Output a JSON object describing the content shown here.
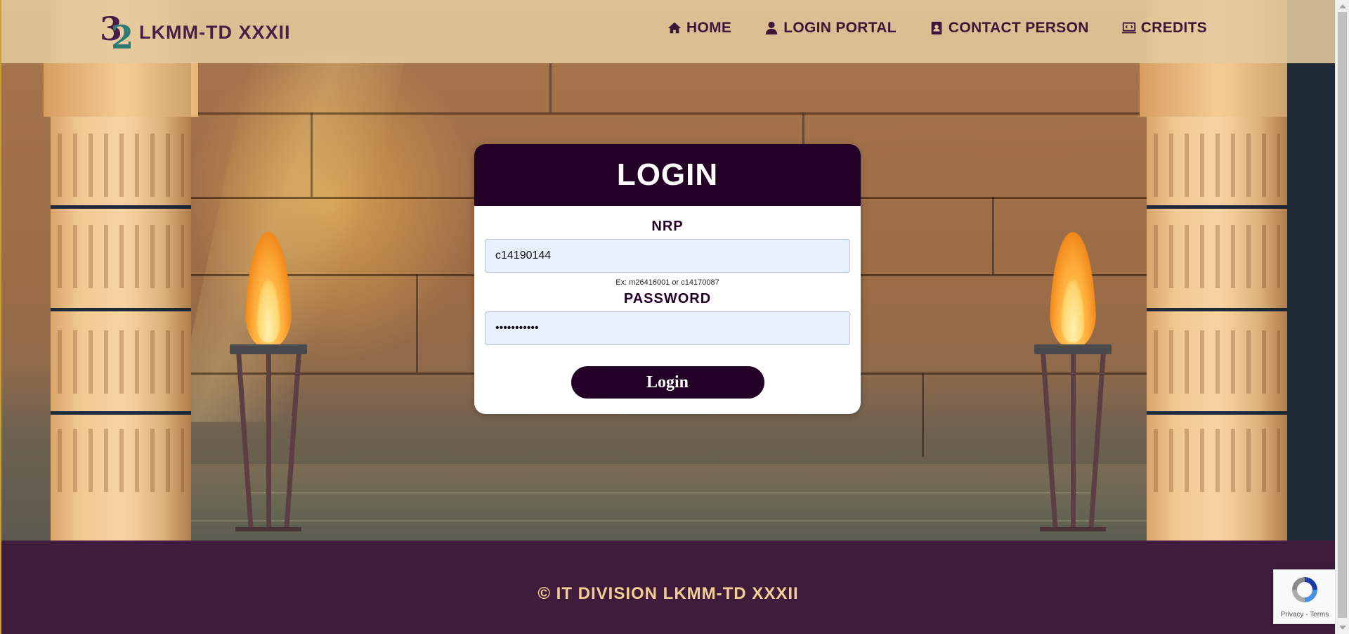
{
  "brand": {
    "name": "LKMM-TD XXXII",
    "logo_text_1": "3",
    "logo_text_2": "2"
  },
  "nav": {
    "items": [
      {
        "label": "HOME",
        "icon": "home-icon"
      },
      {
        "label": "LOGIN PORTAL",
        "icon": "user-icon"
      },
      {
        "label": "CONTACT PERSON",
        "icon": "contact-book-icon"
      },
      {
        "label": "CREDITS",
        "icon": "laptop-code-icon"
      }
    ]
  },
  "login": {
    "title": "LOGIN",
    "nrp_label": "NRP",
    "nrp_value": "c14190144",
    "hint": "Ex: m26416001 or c14170087",
    "password_label": "PASSWORD",
    "password_value": "•••••••••••",
    "button_label": "Login"
  },
  "footer": {
    "text": "© IT DIVISION LKMM-TD XXXII"
  },
  "recaptcha": {
    "links": "Privacy - Terms"
  },
  "colors": {
    "primary_dark": "#230025",
    "footer_bg": "#3f1c3b",
    "footer_text": "#f1cf94",
    "topbar_bg": "#e3c99d",
    "input_bg": "#e8f0fe"
  }
}
